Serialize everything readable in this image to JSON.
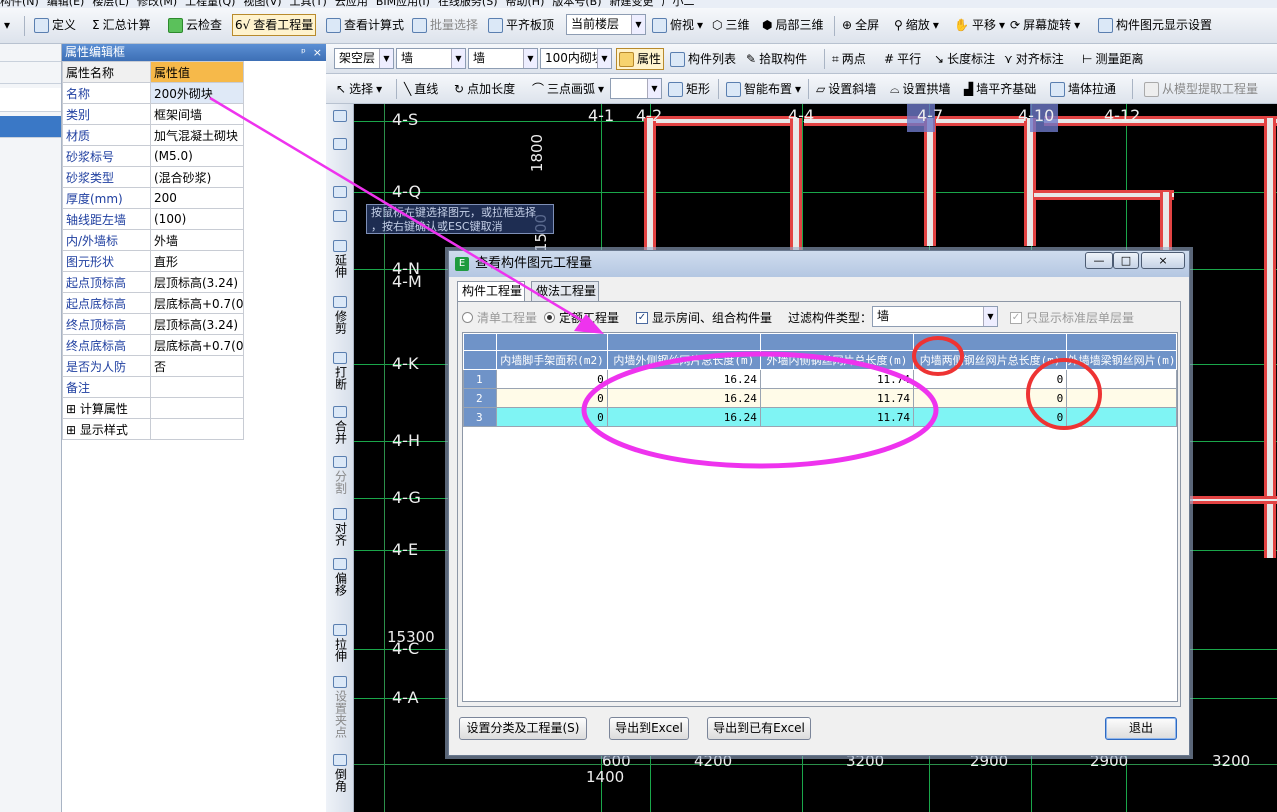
{
  "menu": {
    "items": [
      "构件(N)",
      "编辑(E)",
      "楼层(L)",
      "修改(M)",
      "工程量(Q)",
      "视图(V)",
      "工具(T)",
      "云应用",
      "BIM应用(I)",
      "在线服务(S)",
      "帮助(H)",
      "版本号(B)",
      "新建变更",
      "广小二"
    ]
  },
  "toolbar1": {
    "define": "定义",
    "sum_calc": "汇总计算",
    "cloud_check": "云检查",
    "view_quantity": "查看工程量",
    "view_formula": "查看计算式",
    "batch_select": "批量选择",
    "flat_slab_top": "平齐板顶",
    "floor_select": "当前楼层",
    "top_view": "俯视",
    "three_d": "三维",
    "local_3d": "局部三维",
    "fullscreen": "全屏",
    "zoom": "缩放",
    "pan": "平移",
    "screen_rotate": "屏幕旋转",
    "display_settings": "构件图元显示设置"
  },
  "toolbar2": {
    "layer": "架空层",
    "category": "墙",
    "type": "墙",
    "component": "100内砌块",
    "properties": "属性",
    "component_list": "构件列表",
    "pick_component": "拾取构件",
    "two_points": "两点",
    "parallel": "平行",
    "length_dim": "长度标注",
    "align_dim": "对齐标注",
    "measure": "测量距离"
  },
  "toolbar3": {
    "select": "选择",
    "line": "直线",
    "point_length": "点加长度",
    "three_point_arc": "三点画弧",
    "rect": "矩形",
    "smart_layout": "智能布置",
    "set_slope_wall": "设置斜墙",
    "set_arch_wall": "设置拱墙",
    "wall_flat_base": "墙平齐基础",
    "wall_pull": "墙体拉通",
    "extract_from_model": "从模型提取工程量"
  },
  "left_strip": {
    "selected": "",
    "rows": [
      "",
      "",
      "",
      ""
    ]
  },
  "property_panel": {
    "title": "属性编辑框",
    "pin": "ᵖ",
    "close": "×",
    "col_name": "属性名称",
    "col_value": "属性值",
    "rows": [
      {
        "name": "名称",
        "value": "200外砌块"
      },
      {
        "name": "类别",
        "value": "框架间墙"
      },
      {
        "name": "材质",
        "value": "加气混凝土砌块"
      },
      {
        "name": "砂浆标号",
        "value": "(M5.0)"
      },
      {
        "name": "砂浆类型",
        "value": "(混合砂浆)"
      },
      {
        "name": "厚度(mm)",
        "value": "200"
      },
      {
        "name": "轴线距左墙",
        "value": "(100)"
      },
      {
        "name": "内/外墙标",
        "value": "外墙"
      },
      {
        "name": "图元形状",
        "value": "直形"
      },
      {
        "name": "起点顶标高",
        "value": "层顶标高(3.24)"
      },
      {
        "name": "起点底标高",
        "value": "层底标高+0.7(0"
      },
      {
        "name": "终点顶标高",
        "value": "层顶标高(3.24)"
      },
      {
        "name": "终点底标高",
        "value": "层底标高+0.7(0"
      },
      {
        "name": "是否为人防",
        "value": "否"
      },
      {
        "name": "备注",
        "value": ""
      }
    ],
    "groups": [
      "计算属性",
      "显示样式"
    ]
  },
  "vertical_tools": [
    "延伸",
    "修剪",
    "打断",
    "合并",
    "分割",
    "对齐",
    "偏移",
    "拉伸",
    "设置夹点",
    "倒角"
  ],
  "canvas": {
    "axes_left": [
      "4-S",
      "4-Q",
      "4-N",
      "4-M",
      "4-K",
      "4-H",
      "4-G",
      "4-E",
      "4-C",
      "4-A"
    ],
    "axes_top": [
      "4-1",
      "4-2",
      "4-4",
      "4-7",
      "4-10",
      "4-12"
    ],
    "dims": [
      "1800",
      "1500",
      "15300",
      "600",
      "1400",
      "4200",
      "3200",
      "2900",
      "2900",
      "3200"
    ],
    "tooltip_line1": "按鼠标左键选择图元，或拉框选择",
    "tooltip_line2": "，按右键确认或ESC键取消"
  },
  "dialog": {
    "title": "查看构件图元工程量",
    "minimize": "—",
    "restore": "□",
    "close": "×",
    "tabs": [
      "构件工程量",
      "做法工程量"
    ],
    "radio_list": "清单工程量",
    "radio_quota": "定额工程量",
    "show_rooms": "显示房间、组合构件量",
    "filter_label": "过滤构件类型：",
    "filter_value": "墙",
    "std_floor_only": "只显示标准层单层量",
    "columns": [
      "内墙脚手架面积(m2)",
      "内墙外侧钢丝网片总长度(m)",
      "外墙内侧钢丝网片总长度(m)",
      "内墙两侧钢丝网片总长度(m)",
      "外墙墙梁钢丝网片(m)"
    ],
    "rows": [
      {
        "no": "1",
        "cells": [
          "0",
          "16.24",
          "11.74",
          "0",
          ""
        ]
      },
      {
        "no": "2",
        "cells": [
          "0",
          "16.24",
          "11.74",
          "0",
          ""
        ]
      },
      {
        "no": "3",
        "cells": [
          "0",
          "16.24",
          "11.74",
          "0",
          ""
        ]
      }
    ],
    "btn_classify": "设置分类及工程量(S)",
    "btn_export_excel": "导出到Excel",
    "btn_export_existing": "导出到已有Excel",
    "btn_exit": "退出"
  },
  "colors": {
    "annotation": "#ee33ee",
    "circle": "#ee3333",
    "grid_header": "#6f93c8",
    "selected_row": "#7ff4f4"
  }
}
